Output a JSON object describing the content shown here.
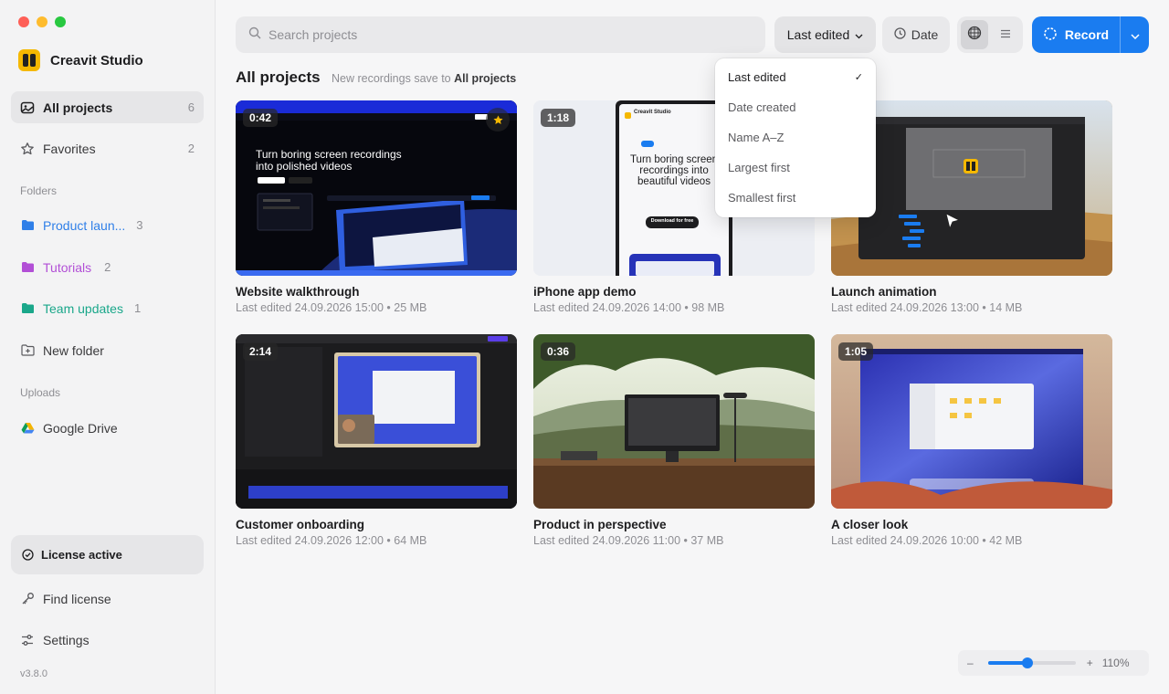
{
  "app": {
    "name": "Creavit Studio",
    "version": "v3.8.0"
  },
  "sidebar": {
    "items": [
      {
        "label": "All projects",
        "count": "6"
      },
      {
        "label": "Favorites",
        "count": "2"
      }
    ],
    "folders_label": "Folders",
    "folders": [
      {
        "label": "Product laun...",
        "count": "3",
        "color": "#2f7fe8"
      },
      {
        "label": "Tutorials",
        "count": "2",
        "color": "#b24fd6"
      },
      {
        "label": "Team updates",
        "count": "1",
        "color": "#1aa78a"
      }
    ],
    "new_folder": "New folder",
    "uploads_label": "Uploads",
    "google_drive": "Google Drive",
    "license": "License active",
    "find_license": "Find license",
    "settings": "Settings"
  },
  "toolbar": {
    "search_placeholder": "Search projects",
    "sort_label": "Last edited",
    "date_label": "Date",
    "record_label": "Record"
  },
  "main": {
    "title": "All projects",
    "subtitle_prefix": "New recordings save to",
    "subtitle_target": "All projects"
  },
  "sort_menu": {
    "options": [
      "Last edited",
      "Date created",
      "Name A–Z",
      "Largest first",
      "Smallest first"
    ],
    "selected": "Last edited"
  },
  "projects": [
    {
      "title": "Website walkthrough",
      "meta": "Last edited 24.09.2026 15:00 • 25 MB",
      "duration": "0:42",
      "favorite": true
    },
    {
      "title": "iPhone app demo",
      "meta": "Last edited 24.09.2026 14:00 • 98 MB",
      "duration": "1:18",
      "favorite": false
    },
    {
      "title": "Launch animation",
      "meta": "Last edited 24.09.2026 13:00 • 14 MB",
      "duration": "",
      "favorite": false
    },
    {
      "title": "Customer onboarding",
      "meta": "Last edited 24.09.2026 12:00 • 64 MB",
      "duration": "2:14",
      "favorite": false
    },
    {
      "title": "Product in perspective",
      "meta": "Last edited 24.09.2026 11:00 • 37 MB",
      "duration": "0:36",
      "favorite": false
    },
    {
      "title": "A closer look",
      "meta": "Last edited 24.09.2026 10:00 • 42 MB",
      "duration": "1:05",
      "favorite": false
    }
  ],
  "thumb_texts": {
    "website_headline": "Turn boring screen recordings into polished videos",
    "iphone_app": "Creavit Studio",
    "iphone_headline": "Turn boring screen recordings into beautiful videos",
    "iphone_button": "Download for free"
  },
  "zoom": {
    "minus": "–",
    "plus": "+",
    "value_label": "110%",
    "fraction": 0.45
  },
  "colors": {
    "accent": "#1a7cf0",
    "star": "#f5b800"
  }
}
